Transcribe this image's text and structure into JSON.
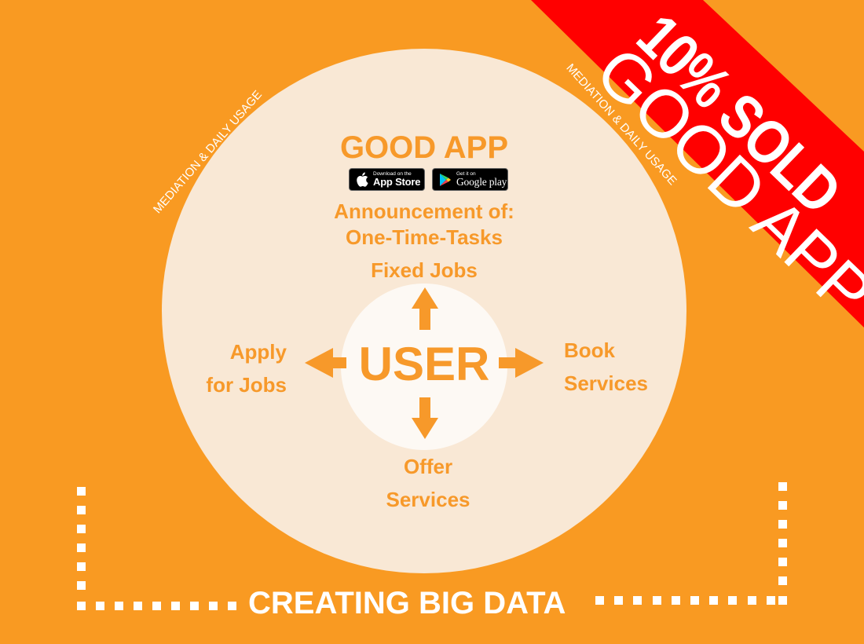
{
  "colors": {
    "background": "#F99A22",
    "circle_fill": "#F9E8D5",
    "inner_circle_fill": "#FDF9F4",
    "accent_text": "#F7992A",
    "banner_red": "#FF0000",
    "white": "#FFFFFF"
  },
  "banner": {
    "line1": "10% SOLD",
    "line2": "GOOD APP"
  },
  "side_labels": {
    "left": "MEDIATION & DAILY USAGE",
    "right": "MEDIATION & DAILY USAGE"
  },
  "app": {
    "title": "GOOD APP",
    "badges": {
      "app_store": {
        "small": "Download on the",
        "big": "App Store",
        "icon": "apple-icon"
      },
      "google_play": {
        "small": "Get it on",
        "big": "Google play",
        "icon": "play-triangle-icon"
      }
    }
  },
  "announcement": {
    "line1": "Announcement of:",
    "line2": "One-Time-Tasks",
    "line3": "Fixed Jobs"
  },
  "center": {
    "label": "USER",
    "arrows": [
      "arrow-up-icon",
      "arrow-left-icon",
      "arrow-right-icon",
      "arrow-down-icon"
    ]
  },
  "actions": {
    "apply": {
      "line1": "Apply",
      "line2": "for Jobs"
    },
    "book": {
      "line1": "Book",
      "line2": "Services"
    },
    "offer": {
      "line1": "Offer",
      "line2": "Services"
    }
  },
  "footer": {
    "label": "CREATING BIG DATA"
  }
}
